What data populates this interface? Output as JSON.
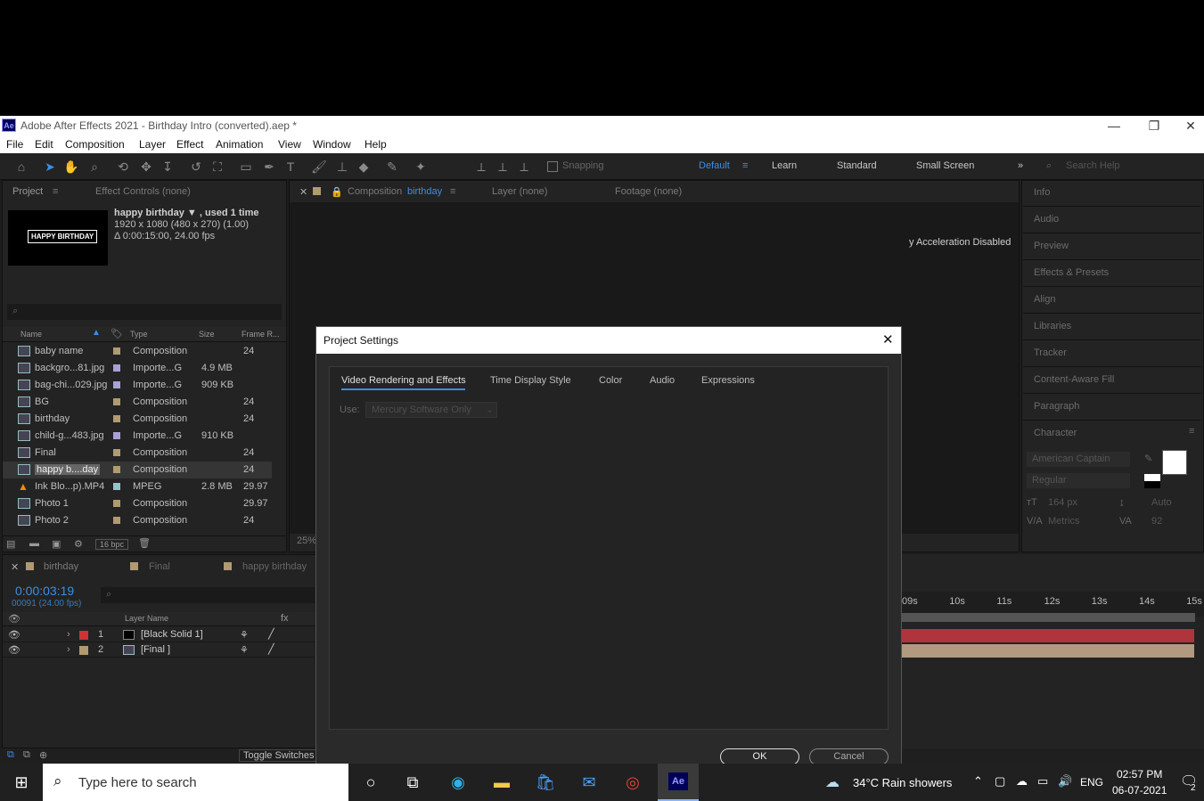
{
  "window": {
    "title": "Adobe After Effects 2021 - Birthday Intro (converted).aep *",
    "logo": "Ae",
    "min": "—",
    "max": "❐",
    "close": "✕"
  },
  "menu": [
    "File",
    "Edit",
    "Composition",
    "Layer",
    "Effect",
    "Animation",
    "View",
    "Window",
    "Help"
  ],
  "toolbar": {
    "snapping": "Snapping",
    "workspaces": [
      "Default",
      "Learn",
      "Standard",
      "Small Screen"
    ],
    "search_placeholder": "Search Help"
  },
  "project": {
    "tab": "Project",
    "effect_controls": "Effect Controls (none)",
    "item_name": "happy birthday ▼ , used 1 time",
    "item_dims": "1920 x 1080  (480 x 270) (1.00)",
    "item_dur": "Δ 0:00:15:00, 24.00 fps",
    "thumb_text": "HAPPY BIRTHDAY",
    "columns": [
      "Name",
      "Type",
      "Size",
      "Frame R..."
    ],
    "rows": [
      {
        "name": "baby name",
        "type": "Composition",
        "size": "",
        "fps": "24",
        "color": "#b19a70",
        "icon": "comp-icon"
      },
      {
        "name": "backgro...81.jpg",
        "type": "Importe...G",
        "size": "4.9 MB",
        "fps": "",
        "color": "#a8a0d8",
        "icon": "image-icon"
      },
      {
        "name": "bag-chi...029.jpg",
        "type": "Importe...G",
        "size": "909 KB",
        "fps": "",
        "color": "#a8a0d8",
        "icon": "image-icon"
      },
      {
        "name": "BG",
        "type": "Composition",
        "size": "",
        "fps": "24",
        "color": "#b19a70",
        "icon": "comp-icon"
      },
      {
        "name": "birthday",
        "type": "Composition",
        "size": "",
        "fps": "24",
        "color": "#b19a70",
        "icon": "comp-icon"
      },
      {
        "name": "child-g...483.jpg",
        "type": "Importe...G",
        "size": "910 KB",
        "fps": "",
        "color": "#a8a0d8",
        "icon": "image-icon"
      },
      {
        "name": "Final",
        "type": "Composition",
        "size": "",
        "fps": "24",
        "color": "#b19a70",
        "icon": "comp-icon"
      },
      {
        "name": "happy b....day",
        "type": "Composition",
        "size": "",
        "fps": "24",
        "color": "#b19a70",
        "icon": "comp-icon"
      },
      {
        "name": "Ink Blo...p).MP4",
        "type": "MPEG",
        "size": "2.8 MB",
        "fps": "29.97",
        "color": "#8fc6c8",
        "icon": "vlc-icon"
      },
      {
        "name": "Photo 1",
        "type": "Composition",
        "size": "",
        "fps": "29.97",
        "color": "#b19a70",
        "icon": "comp-icon"
      },
      {
        "name": "Photo 2",
        "type": "Composition",
        "size": "",
        "fps": "24",
        "color": "#b19a70",
        "icon": "comp-icon"
      }
    ],
    "bpc": "16 bpc"
  },
  "comp": {
    "tab_prefix": "Composition",
    "tab_name": "birthday",
    "layer": "Layer (none)",
    "footage": "Footage (none)",
    "accel": "y Acceleration Disabled",
    "zoom": "25%"
  },
  "right_panels": [
    "Info",
    "Audio",
    "Preview",
    "Effects & Presets",
    "Align",
    "Libraries",
    "Tracker",
    "Content-Aware Fill",
    "Paragraph",
    "Character"
  ],
  "character": {
    "font": "American Captain",
    "style": "Regular",
    "size": "164 px",
    "leading": "Auto",
    "kerning": "Metrics",
    "tracking": "92"
  },
  "timeline": {
    "tabs": [
      "birthday",
      "Final",
      "happy birthday"
    ],
    "timecode": "0:00:03:19",
    "frames": "00091 (24.00 fps)",
    "layer_header": "Layer Name",
    "layers": [
      {
        "num": "1",
        "name": "[Black Solid 1]",
        "color": "#c33"
      },
      {
        "num": "2",
        "name": "[Final ]",
        "color": "#b19a70"
      }
    ],
    "ruler": [
      "09s",
      "10s",
      "11s",
      "12s",
      "13s",
      "14s",
      "15s"
    ],
    "toggle": "Toggle Switches / Modes"
  },
  "dialog": {
    "title": "Project Settings",
    "tabs": [
      "Video Rendering and Effects",
      "Time Display Style",
      "Color",
      "Audio",
      "Expressions"
    ],
    "use_label": "Use:",
    "use_value": "Mercury Software Only",
    "ok": "OK",
    "cancel": "Cancel"
  },
  "taskbar": {
    "search": "Type here to search",
    "weather": "34°C  Rain showers",
    "lang": "ENG",
    "time": "02:57 PM",
    "date": "06-07-2021",
    "notif": "2"
  }
}
